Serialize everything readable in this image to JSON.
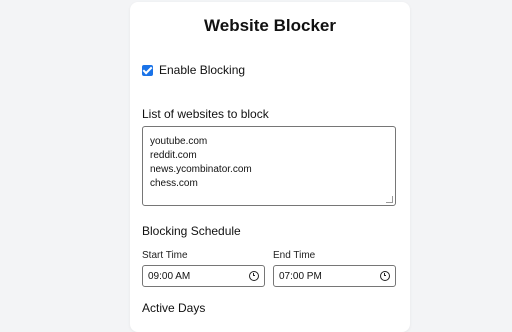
{
  "title": "Website Blocker",
  "enable": {
    "label": "Enable Blocking",
    "checked": true
  },
  "websites": {
    "label": "List of websites to block",
    "lines": [
      "youtube.com",
      "reddit.com",
      "news.ycombinator.com",
      "chess.com"
    ]
  },
  "schedule": {
    "label": "Blocking Schedule",
    "start_label": "Start Time",
    "start_value": "09:00 AM",
    "end_label": "End Time",
    "end_value": "07:00 PM"
  },
  "active_days": {
    "label": "Active Days"
  },
  "colors": {
    "accent": "#1a73e8",
    "panel_bg": "#ffffff",
    "page_bg": "#f3f4f6"
  },
  "icons": {
    "checkbox": "checkmark-icon",
    "time": "clock-icon"
  }
}
